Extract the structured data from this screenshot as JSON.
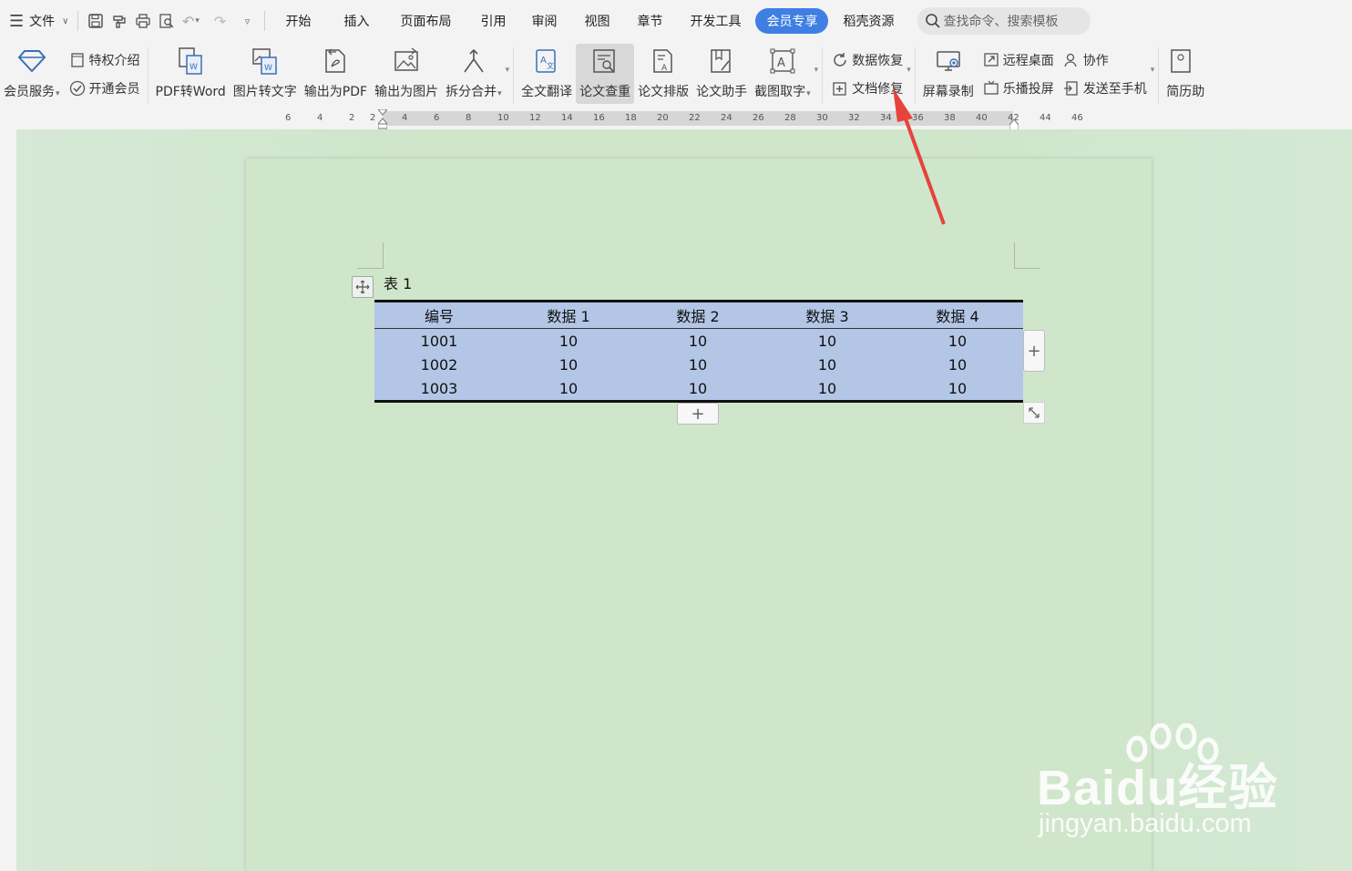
{
  "menubar": {
    "file_label": "文件",
    "tabs": [
      {
        "label": "开始"
      },
      {
        "label": "插入"
      },
      {
        "label": "页面布局"
      },
      {
        "label": "引用"
      },
      {
        "label": "审阅"
      },
      {
        "label": "视图"
      },
      {
        "label": "章节"
      },
      {
        "label": "开发工具"
      },
      {
        "label": "会员专享"
      },
      {
        "label": "稻壳资源"
      }
    ],
    "search_placeholder": "查找命令、搜索模板"
  },
  "ribbon": {
    "vip_service": "会员服务",
    "privilege_intro": "特权介绍",
    "open_membership": "开通会员",
    "pdf_to_word": "PDF转Word",
    "image_to_text": "图片转文字",
    "export_pdf": "输出为PDF",
    "export_image": "输出为图片",
    "split_merge": "拆分合并",
    "full_translate": "全文翻译",
    "paper_check": "论文查重",
    "paper_layout": "论文排版",
    "paper_assistant": "论文助手",
    "screenshot_ocr": "截图取字",
    "data_recovery": "数据恢复",
    "doc_repair": "文档修复",
    "screen_record": "屏幕录制",
    "remote_desktop": "远程桌面",
    "leplay_cast": "乐播投屏",
    "collaborate": "协作",
    "send_to_phone": "发送至手机",
    "resume": "简历助"
  },
  "ruler": {
    "ticks": [
      "6",
      "4",
      "2",
      "2",
      "4",
      "6",
      "8",
      "10",
      "12",
      "14",
      "16",
      "18",
      "20",
      "22",
      "24",
      "26",
      "28",
      "30",
      "32",
      "34",
      "36",
      "38",
      "40",
      "42",
      "44",
      "46"
    ]
  },
  "document": {
    "caption": "表 1",
    "table": {
      "headers": [
        "编号",
        "数据 1",
        "数据 2",
        "数据 3",
        "数据 4"
      ],
      "rows": [
        [
          "1001",
          "10",
          "10",
          "10",
          "10"
        ],
        [
          "1002",
          "10",
          "10",
          "10",
          "10"
        ],
        [
          "1003",
          "10",
          "10",
          "10",
          "10"
        ]
      ]
    },
    "add_symbol": "+"
  },
  "watermark": {
    "brand": "Baidu经验",
    "site": "jingyan.baidu.com"
  },
  "colors": {
    "active_tab": "#3f7fe4",
    "table_fill": "#b3c6e6",
    "page_bg": "#cfe6cb",
    "arrow": "#e8423a"
  }
}
